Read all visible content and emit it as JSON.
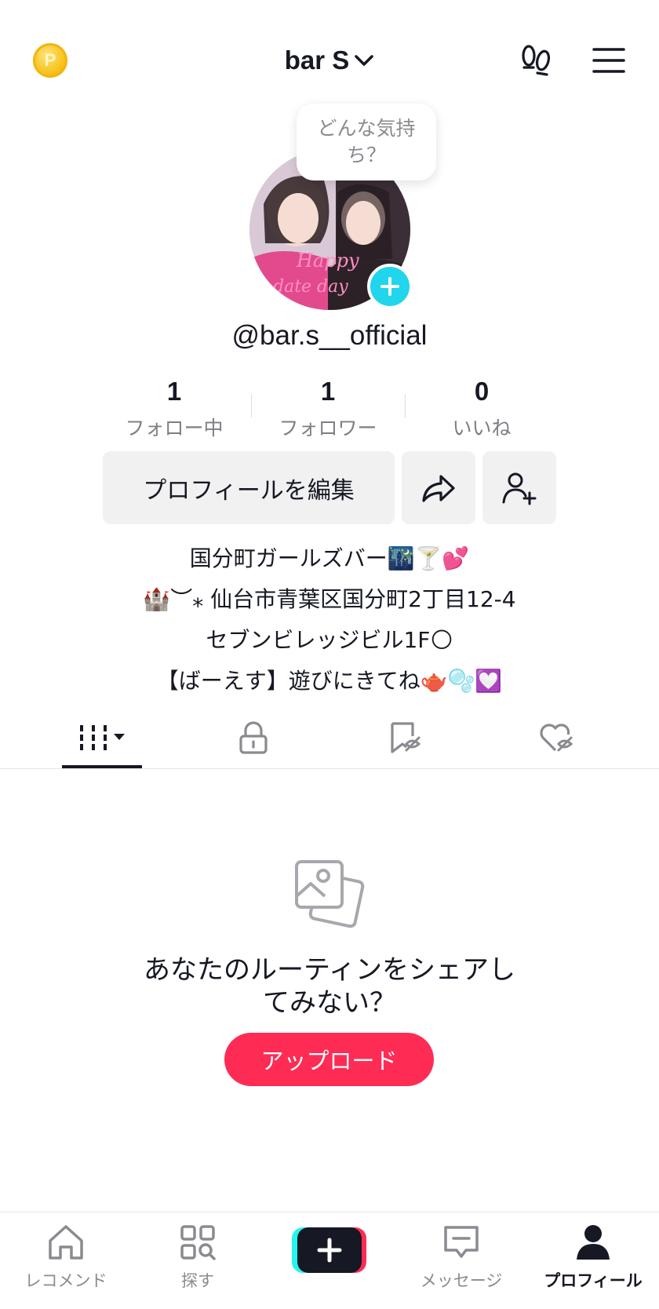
{
  "header": {
    "coin_icon": "points-coin-icon",
    "coin_letter": "P",
    "account_name": "bar S"
  },
  "profile": {
    "bubble_text": "どんな気持ち？",
    "username": "@bar.s__official",
    "stats": [
      {
        "value": "1",
        "label": "フォロー中"
      },
      {
        "value": "1",
        "label": "フォロワー"
      },
      {
        "value": "0",
        "label": "いいね"
      }
    ],
    "edit_label": "プロフィールを編集",
    "bio": [
      "国分町ガールズバー🌃🍸💕",
      "🏰︶⁎ 仙台市青葉区国分町2丁目12-4",
      "セブンビレッジビル1F🌕",
      "【ばーえす】遊びにきてね🫖🫧💟"
    ]
  },
  "empty_state": {
    "line1": "あなたのルーティンをシェアし",
    "line2": "てみない？",
    "upload_label": "アップロード"
  },
  "bottom_nav": [
    {
      "label": "レコメンド",
      "icon": "home-icon"
    },
    {
      "label": "探す",
      "icon": "discover-icon"
    },
    {
      "label": "",
      "icon": "create-icon"
    },
    {
      "label": "メッセージ",
      "icon": "inbox-icon"
    },
    {
      "label": "プロフィール",
      "icon": "profile-icon"
    }
  ],
  "colors": {
    "accent": "#fe2c55",
    "cyan": "#20d5ec",
    "text": "#161823",
    "muted": "#8a8b91"
  }
}
